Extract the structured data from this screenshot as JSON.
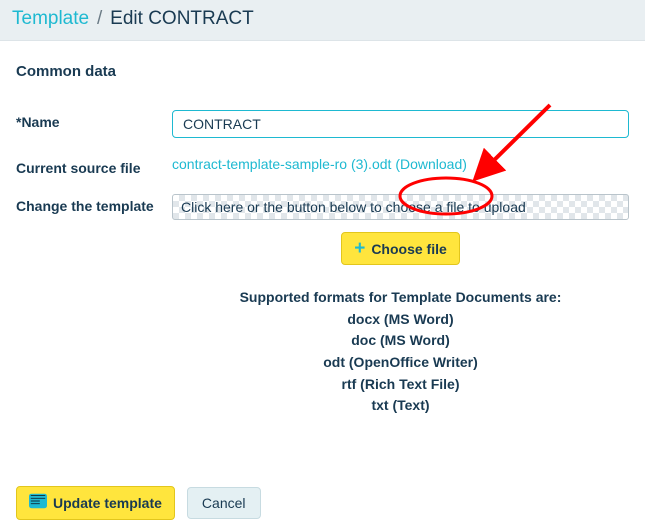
{
  "breadcrumb": {
    "root": "Template",
    "sep": "/",
    "current": "Edit CONTRACT"
  },
  "section_title": "Common data",
  "name": {
    "label": "*Name",
    "value": "CONTRACT"
  },
  "current_file": {
    "label": "Current source file",
    "filename": "contract-template-sample-ro (3).odt",
    "download": "(Download)"
  },
  "change_template": {
    "label": "Change the template",
    "placeholder": "Click here or the button below to choose a file to upload",
    "choose_btn": "Choose file"
  },
  "supported": {
    "intro": "Supported formats for Template Documents are:",
    "f1": "docx (MS Word)",
    "f2": "doc (MS Word)",
    "f3": "odt (OpenOffice Writer)",
    "f4": "rtf (Rich Text File)",
    "f5": "txt (Text)"
  },
  "footer": {
    "update": "Update template",
    "cancel": "Cancel"
  }
}
